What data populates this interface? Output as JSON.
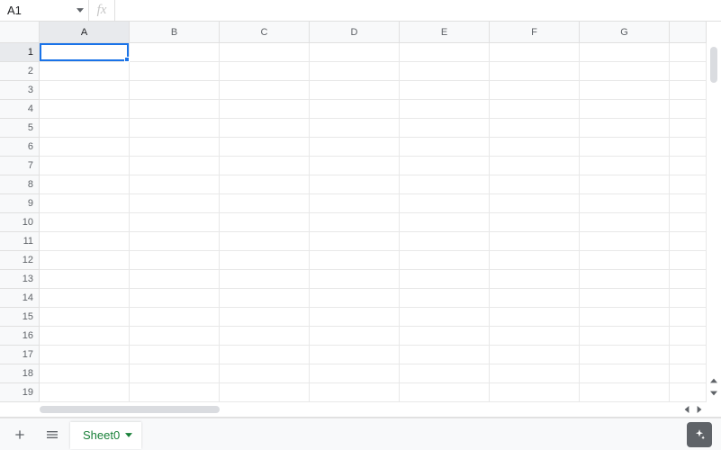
{
  "formula_bar": {
    "cell_ref": "A1",
    "fx_label": "fx",
    "value": ""
  },
  "grid": {
    "columns": [
      "A",
      "B",
      "C",
      "D",
      "E",
      "F",
      "G"
    ],
    "rows": [
      "1",
      "2",
      "3",
      "4",
      "5",
      "6",
      "7",
      "8",
      "9",
      "10",
      "11",
      "12",
      "13",
      "14",
      "15",
      "16",
      "17",
      "18",
      "19"
    ],
    "active_column": "A",
    "active_row": "1",
    "selected_cell": "A1"
  },
  "tabs": {
    "active_sheet_name": "Sheet0"
  }
}
